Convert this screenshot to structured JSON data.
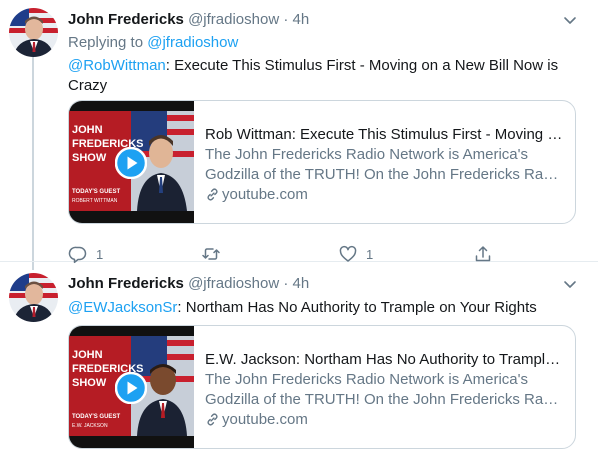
{
  "tweets": [
    {
      "display_name": "John Fredericks",
      "handle": "@jfradioshow",
      "dot": "·",
      "time": "4h",
      "replying_prefix": "Replying to",
      "replying_handle": "@jfradioshow",
      "mention": "@RobWittman",
      "text": ": Execute This Stimulus First - Moving on a New Bill Now is Crazy",
      "card": {
        "title": "Rob Wittman: Execute This Stimulus First - Moving o...",
        "desc_line1": "The John Fredericks Radio Network is America's",
        "desc_line2": "Godzilla of the TRUTH! On the John Fredericks Radio...",
        "link": "youtube.com",
        "thumb_text": [
          "JOHN",
          "FREDERICKS",
          "SHOW",
          "TODAY'S GUEST",
          "ROBERT WITTMAN"
        ]
      },
      "actions": {
        "reply_count": "1",
        "retweet_count": "",
        "like_count": "1"
      }
    },
    {
      "display_name": "John Fredericks",
      "handle": "@jfradioshow",
      "dot": "·",
      "time": "4h",
      "mention": "@EWJacksonSr",
      "text": ": Northam Has No Authority to Trample on Your Rights",
      "card": {
        "title": "E.W. Jackson: Northam Has No Authority to Trample ...",
        "desc_line1": "The John Fredericks Radio Network is America's",
        "desc_line2": "Godzilla of the TRUTH! On the John Fredericks Radio...",
        "link": "youtube.com",
        "thumb_text": [
          "JOHN",
          "FREDERICKS",
          "SHOW",
          "TODAY'S GUEST",
          "E.W. JACKSON"
        ]
      }
    }
  ],
  "colors": {
    "accent": "#1da1f2",
    "secondary_text": "#657786",
    "thumb_red": "#b51c24",
    "play_button": "#1da1f2"
  },
  "icons": [
    "chevron-down-icon",
    "reply-icon",
    "retweet-icon",
    "like-icon",
    "share-icon",
    "link-icon",
    "play-icon"
  ]
}
